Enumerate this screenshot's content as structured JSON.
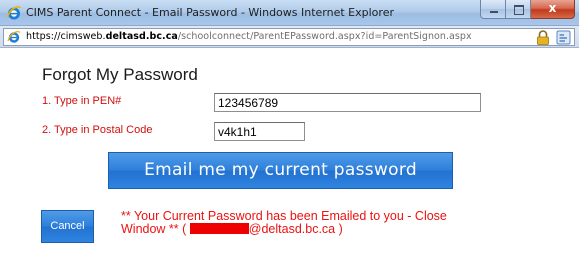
{
  "window": {
    "title": "CIMS Parent Connect - Email Password - Windows Internet Explorer",
    "close_glyph": "x"
  },
  "address_bar": {
    "url_prefix": "https://cimsweb.",
    "url_domain": "deltasd.bc.ca",
    "url_path": "/schoolconnect/ParentEPassword.aspx?id=ParentSignon.aspx"
  },
  "page": {
    "title": "Forgot My Password",
    "pen_label": "1. Type in PEN#",
    "pen_value": "123456789",
    "postal_label": "2. Type in Postal Code",
    "postal_value": "v4k1h1",
    "email_button_label": "Email me my current password",
    "cancel_button_label": "Cancel",
    "status_message_line1": "** Your Current Password has been Emailed to you - Close",
    "status_message_line2_prefix": "Window ** ( ",
    "status_message_line2_suffix": "@deltasd.bc.ca )"
  },
  "colors": {
    "label_red": "#d01010",
    "message_red": "#ee1111",
    "button_blue": "#2f80dc"
  },
  "icons": {
    "app": "ie-icon",
    "address": "ie-page-icon",
    "security": "lock-icon",
    "compatibility": "compatibility-view-icon"
  }
}
